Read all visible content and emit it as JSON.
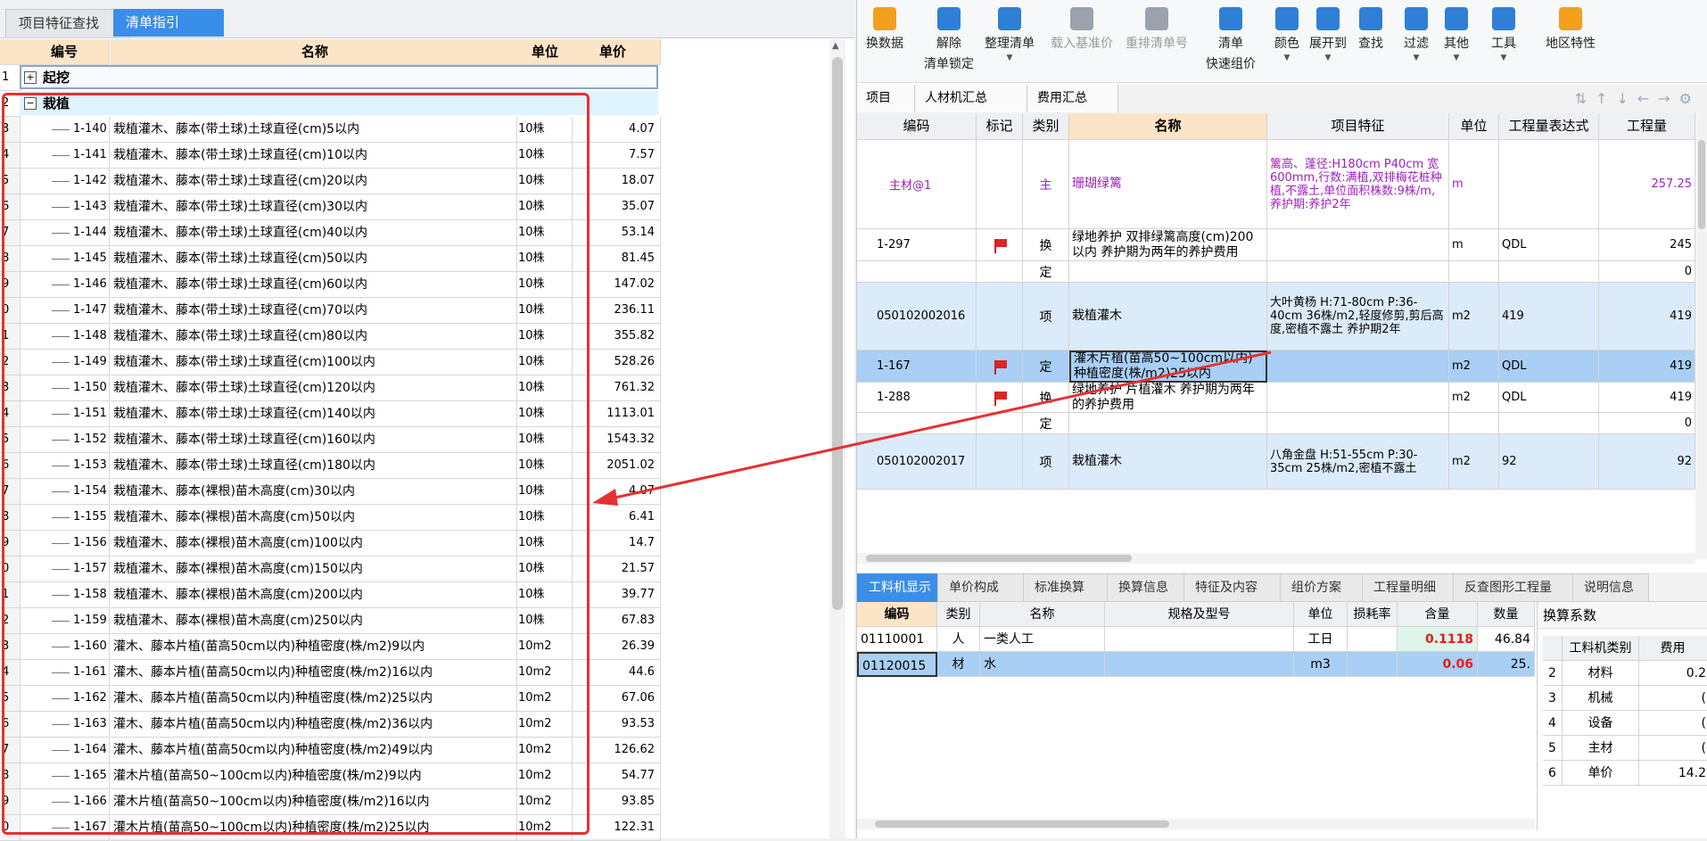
{
  "left_tabs": [
    "项目特征查找",
    "清单指引"
  ],
  "left_table": {
    "headers": {
      "code": "编号",
      "name": "名称",
      "unit": "单位",
      "price": "单价"
    },
    "groups": [
      {
        "rn": "1",
        "expander": "+",
        "label": "起挖"
      },
      {
        "rn": "2",
        "expander": "−",
        "label": "栽植"
      }
    ],
    "rows": [
      {
        "rn": "3",
        "code": "1-140",
        "name": "栽植灌木、藤本(带土球)土球直径(cm)5以内",
        "unit": "10株",
        "price": "4.07"
      },
      {
        "rn": "4",
        "code": "1-141",
        "name": "栽植灌木、藤本(带土球)土球直径(cm)10以内",
        "unit": "10株",
        "price": "7.57"
      },
      {
        "rn": "5",
        "code": "1-142",
        "name": "栽植灌木、藤本(带土球)土球直径(cm)20以内",
        "unit": "10株",
        "price": "18.07"
      },
      {
        "rn": "6",
        "code": "1-143",
        "name": "栽植灌木、藤本(带土球)土球直径(cm)30以内",
        "unit": "10株",
        "price": "35.07"
      },
      {
        "rn": "7",
        "code": "1-144",
        "name": "栽植灌木、藤本(带土球)土球直径(cm)40以内",
        "unit": "10株",
        "price": "53.14"
      },
      {
        "rn": "8",
        "code": "1-145",
        "name": "栽植灌木、藤本(带土球)土球直径(cm)50以内",
        "unit": "10株",
        "price": "81.45"
      },
      {
        "rn": "9",
        "code": "1-146",
        "name": "栽植灌木、藤本(带土球)土球直径(cm)60以内",
        "unit": "10株",
        "price": "147.02"
      },
      {
        "rn": "0",
        "code": "1-147",
        "name": "栽植灌木、藤本(带土球)土球直径(cm)70以内",
        "unit": "10株",
        "price": "236.11"
      },
      {
        "rn": "1",
        "code": "1-148",
        "name": "栽植灌木、藤本(带土球)土球直径(cm)80以内",
        "unit": "10株",
        "price": "355.82"
      },
      {
        "rn": "2",
        "code": "1-149",
        "name": "栽植灌木、藤本(带土球)土球直径(cm)100以内",
        "unit": "10株",
        "price": "528.26"
      },
      {
        "rn": "3",
        "code": "1-150",
        "name": "栽植灌木、藤本(带土球)土球直径(cm)120以内",
        "unit": "10株",
        "price": "761.32"
      },
      {
        "rn": "4",
        "code": "1-151",
        "name": "栽植灌木、藤本(带土球)土球直径(cm)140以内",
        "unit": "10株",
        "price": "1113.01"
      },
      {
        "rn": "5",
        "code": "1-152",
        "name": "栽植灌木、藤本(带土球)土球直径(cm)160以内",
        "unit": "10株",
        "price": "1543.32"
      },
      {
        "rn": "6",
        "code": "1-153",
        "name": "栽植灌木、藤本(带土球)土球直径(cm)180以内",
        "unit": "10株",
        "price": "2051.02"
      },
      {
        "rn": "7",
        "code": "1-154",
        "name": "栽植灌木、藤本(裸根)苗木高度(cm)30以内",
        "unit": "10株",
        "price": "4.07"
      },
      {
        "rn": "8",
        "code": "1-155",
        "name": "栽植灌木、藤本(裸根)苗木高度(cm)50以内",
        "unit": "10株",
        "price": "6.41"
      },
      {
        "rn": "9",
        "code": "1-156",
        "name": "栽植灌木、藤本(裸根)苗木高度(cm)100以内",
        "unit": "10株",
        "price": "14.7"
      },
      {
        "rn": "0",
        "code": "1-157",
        "name": "栽植灌木、藤本(裸根)苗木高度(cm)150以内",
        "unit": "10株",
        "price": "21.57"
      },
      {
        "rn": "1",
        "code": "1-158",
        "name": "栽植灌木、藤本(裸根)苗木高度(cm)200以内",
        "unit": "10株",
        "price": "39.77"
      },
      {
        "rn": "2",
        "code": "1-159",
        "name": "栽植灌木、藤本(裸根)苗木高度(cm)250以内",
        "unit": "10株",
        "price": "67.83"
      },
      {
        "rn": "3",
        "code": "1-160",
        "name": "灌木、藤本片植(苗高50cm以内)种植密度(株/m2)9以内",
        "unit": "10m2",
        "price": "26.39"
      },
      {
        "rn": "4",
        "code": "1-161",
        "name": "灌木、藤本片植(苗高50cm以内)种植密度(株/m2)16以内",
        "unit": "10m2",
        "price": "44.6"
      },
      {
        "rn": "5",
        "code": "1-162",
        "name": "灌木、藤本片植(苗高50cm以内)种植密度(株/m2)25以内",
        "unit": "10m2",
        "price": "67.06"
      },
      {
        "rn": "6",
        "code": "1-163",
        "name": "灌木、藤本片植(苗高50cm以内)种植密度(株/m2)36以内",
        "unit": "10m2",
        "price": "93.53"
      },
      {
        "rn": "7",
        "code": "1-164",
        "name": "灌木、藤本片植(苗高50cm以内)种植密度(株/m2)49以内",
        "unit": "10m2",
        "price": "126.62"
      },
      {
        "rn": "8",
        "code": "1-165",
        "name": "灌木片植(苗高50~100cm以内)种植密度(株/m2)9以内",
        "unit": "10m2",
        "price": "54.77"
      },
      {
        "rn": "9",
        "code": "1-166",
        "name": "灌木片植(苗高50~100cm以内)种植密度(株/m2)16以内",
        "unit": "10m2",
        "price": "93.85"
      },
      {
        "rn": "0",
        "code": "1-167",
        "name": "灌木片植(苗高50~100cm以内)种植密度(株/m2)25以内",
        "unit": "10m2",
        "price": "122.31"
      }
    ]
  },
  "toolbar": [
    {
      "label": "换数据",
      "label2": "",
      "disabled": false,
      "color": "#f2a01e"
    },
    {
      "label": "解除",
      "label2": "清单锁定",
      "disabled": false,
      "color": "#2f7fd6"
    },
    {
      "label": "整理清单",
      "label2": "",
      "disabled": false,
      "color": "#2f7fd6",
      "caret": true
    },
    {
      "label": "载入基准价",
      "label2": "",
      "disabled": true,
      "color": "#9aa3ad"
    },
    {
      "label": "重排清单号",
      "label2": "",
      "disabled": true,
      "color": "#9aa3ad"
    },
    {
      "label": "清单",
      "label2": "快速组价",
      "disabled": false,
      "color": "#2f7fd6"
    },
    {
      "label": "颜色",
      "label2": "",
      "disabled": false,
      "color": "#2f7fd6",
      "caret": true
    },
    {
      "label": "展开到",
      "label2": "",
      "disabled": false,
      "color": "#2f7fd6",
      "caret": true
    },
    {
      "label": "查找",
      "label2": "",
      "disabled": false,
      "color": "#2f7fd6"
    },
    {
      "label": "过滤",
      "label2": "",
      "disabled": false,
      "color": "#2f7fd6",
      "caret": true
    },
    {
      "label": "其他",
      "label2": "",
      "disabled": false,
      "color": "#2f7fd6",
      "caret": true
    },
    {
      "label": "工具",
      "label2": "",
      "disabled": false,
      "color": "#2f7fd6",
      "caret": true
    },
    {
      "label": "地区特性",
      "label2": "",
      "disabled": false,
      "color": "#f2a01e"
    }
  ],
  "sub_tabs": [
    "项目",
    "人材机汇总",
    "费用汇总"
  ],
  "right_table": {
    "headers": {
      "code": "编码",
      "mark": "标记",
      "type": "类别",
      "name": "名称",
      "feature": "项目特征",
      "unit": "单位",
      "expr": "工程量表达式",
      "qty": "工程量"
    },
    "rows": [
      {
        "code": "主材@1",
        "mark": "",
        "type": "主",
        "name": "珊瑚绿篱",
        "feature": "篱高、蓬径:H180cm P40cm 宽600mm,行数:满植,双排梅花桩种植,不露土,单位面积株数:9株/m,养护期:养护2年",
        "unit": "m",
        "expr": "",
        "qty": "257.25",
        "style": "purple"
      },
      {
        "code": "1-297",
        "mark": "flag",
        "type": "换",
        "name": "绿地养护 双排绿篱高度(cm)200以内 养护期为两年的养护费用",
        "feature": "",
        "unit": "m",
        "expr": "QDL",
        "qty": "245",
        "style": ""
      },
      {
        "code": "",
        "mark": "",
        "type": "定",
        "name": "",
        "feature": "",
        "unit": "",
        "expr": "",
        "qty": "0",
        "style": ""
      },
      {
        "code": "050102002016",
        "mark": "",
        "type": "项",
        "name": "栽植灌木",
        "feature": "大叶黄杨 H:71-80cm P:36-40cm 36株/m2,轻度修剪,剪后高度,密植不露土 养护期2年",
        "unit": "m2",
        "expr": "419",
        "qty": "419",
        "style": "blue"
      },
      {
        "code": "1-167",
        "mark": "flag",
        "type": "定",
        "name": "灌木片植(苗高50~100cm以内)种植密度(株/m2)25以内",
        "feature": "",
        "unit": "m2",
        "expr": "QDL",
        "qty": "419",
        "style": "sel"
      },
      {
        "code": "1-288",
        "mark": "flag",
        "type": "换",
        "name": "绿地养护 片植灌木 养护期为两年的养护费用",
        "feature": "",
        "unit": "m2",
        "expr": "QDL",
        "qty": "419",
        "style": ""
      },
      {
        "code": "",
        "mark": "",
        "type": "定",
        "name": "",
        "feature": "",
        "unit": "",
        "expr": "",
        "qty": "0",
        "style": ""
      },
      {
        "code": "050102002017",
        "mark": "",
        "type": "项",
        "name": "栽植灌木",
        "feature": "八角金盘 H:51-55cm P:30-35cm 25株/m2,密植不露土",
        "unit": "m2",
        "expr": "92",
        "qty": "92",
        "style": "blue"
      }
    ]
  },
  "bottom_tabs": [
    "工料机显示",
    "单价构成",
    "标准换算",
    "换算信息",
    "特征及内容",
    "组价方案",
    "工程量明细",
    "反查图形工程量",
    "说明信息"
  ],
  "bottom_table": {
    "headers": {
      "code": "编码",
      "type": "类别",
      "name": "名称",
      "spec": "规格及型号",
      "unit": "单位",
      "loss": "损耗率",
      "content": "含量",
      "num": "数量"
    },
    "rows": [
      {
        "code": "01110001",
        "type": "人",
        "name": "一类人工",
        "spec": "",
        "unit": "工日",
        "loss": "",
        "content": "0.1118",
        "num": "46.84"
      },
      {
        "code": "01120015",
        "type": "材",
        "name": "水",
        "spec": "",
        "unit": "m3",
        "loss": "",
        "content": "0.06",
        "num": "25."
      }
    ]
  },
  "coef_panel": {
    "title": "换算系数",
    "headers": {
      "kind": "工料机类别",
      "fee": "费用"
    },
    "rows": [
      {
        "n": "2",
        "kind": "材料",
        "fee": "0.2"
      },
      {
        "n": "3",
        "kind": "机械",
        "fee": "("
      },
      {
        "n": "4",
        "kind": "设备",
        "fee": "("
      },
      {
        "n": "5",
        "kind": "主材",
        "fee": "("
      },
      {
        "n": "6",
        "kind": "单价",
        "fee": "14.2"
      }
    ]
  },
  "colors": {
    "accent": "#3b8ee8",
    "annotation_red": "#e53131",
    "header_orange": "#fce4c6",
    "selected_row": "#a9cff5"
  }
}
